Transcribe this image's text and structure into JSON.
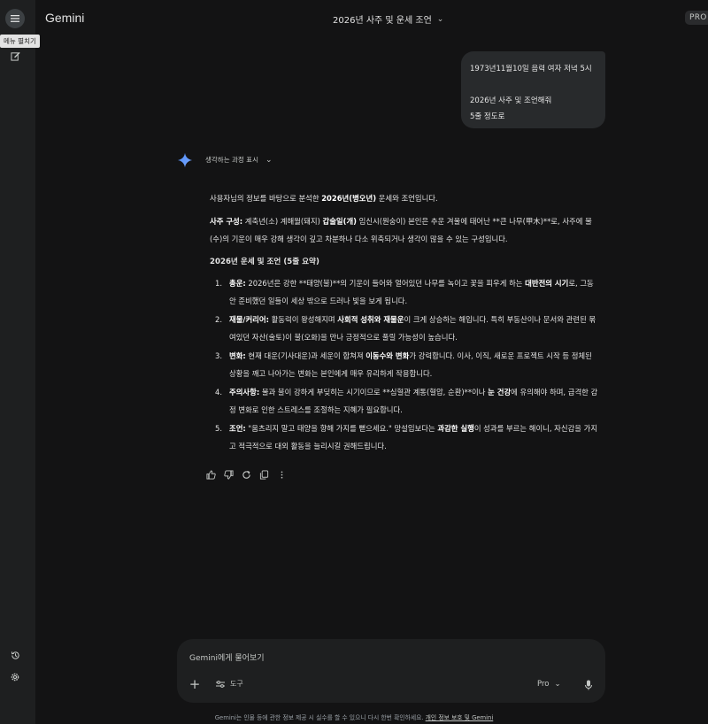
{
  "sidebar": {
    "menu_tooltip": "메뉴 펼치기"
  },
  "header": {
    "brand": "Gemini",
    "chat_title": "2026년 사주 및 운세 조언",
    "badge": "PRO"
  },
  "user_message": {
    "line1": "1973년11월10일 음력 여자 저녁 5시",
    "line2": "2026년 사주 및 조언해줘",
    "line3": "5줄 정도로"
  },
  "thinking": {
    "label": "생각하는 과정 표시"
  },
  "response": {
    "intro_pre": "사용자님의 정보를 바탕으로 분석한 ",
    "intro_bold": "2026년(병오년)",
    "intro_post": " 운세와 조언입니다.",
    "saju_label": "사주 구성:",
    "saju_pre": " 계축년(소) 계해월(돼지) ",
    "saju_bold": "갑술일(개)",
    "saju_post": " 임신시(원숭이) 본인은 추운 겨울에 태어난 **큰 나무(甲木)**로, 사주에 물(수)의 기운이 매우 강해 생각이 깊고 차분하나 다소 위축되거나 생각이 많을 수 있는 구성입니다.",
    "summary_heading": "2026년 운세 및 조언 (5줄 요약)",
    "items": [
      {
        "num": "1.",
        "label": "총운:",
        "pre": " 2026년은 강한 **태양(불)**의 기운이 들어와 얼어있던 나무를 녹이고 꽃을 피우게 하는 ",
        "bold": "대반전의 시기",
        "post": "로, 그동안 준비했던 일들이 세상 밖으로 드러나 빛을 보게 됩니다."
      },
      {
        "num": "2.",
        "label": "재물/커리어:",
        "pre": " 활동력이 왕성해지며 ",
        "bold": "사회적 성취와 재물운",
        "post": "이 크게 상승하는 해입니다. 특히 부동산이나 문서와 관련된 묶여있던 자산(술토)이 불(오화)을 만나 긍정적으로 풀릴 가능성이 높습니다."
      },
      {
        "num": "3.",
        "label": "변화:",
        "pre": " 현재 대운(기사대운)과 세운이 합쳐져 ",
        "bold": "이동수와 변화",
        "post": "가 강력합니다. 이사, 이직, 새로운 프로젝트 시작 등 정체된 상황을 깨고 나아가는 변화는 본인에게 매우 유리하게 작용합니다."
      },
      {
        "num": "4.",
        "label": "주의사항:",
        "pre": " 물과 불이 강하게 부딪히는 시기이므로 **심혈관 계통(혈압, 순환)**이나 ",
        "bold": "눈 건강",
        "post": "에 유의해야 하며, 급격한 감정 변화로 인한 스트레스를 조절하는 지혜가 필요합니다."
      },
      {
        "num": "5.",
        "label": "조언:",
        "pre": " \"움츠리지 말고 태양을 향해 가지를 뻗으세요.\" 망설임보다는 ",
        "bold": "과감한 실행",
        "post": "이 성과를 부르는 해이니, 자신감을 가지고 적극적으로 대외 활동을 늘리시길 권해드립니다."
      }
    ]
  },
  "action_icons": [
    "thumb-up-icon",
    "thumb-down-icon",
    "redo-icon",
    "copy-icon",
    "more-vert-icon"
  ],
  "composer": {
    "placeholder": "Gemini에게 물어보기",
    "tools_label": "도구",
    "model_label": "Pro"
  },
  "footer": {
    "text": "Gemini는 인물 등에 관한 정보 제공 시 실수를 할 수 있으니 다시 한번 확인하세요. ",
    "link": "개인 정보 보호 및 Gemini"
  },
  "colors": {
    "background": "#131314",
    "sidebar": "#1e1f20",
    "bubble": "#282a2c",
    "accent_blue": "#4f8df9"
  }
}
